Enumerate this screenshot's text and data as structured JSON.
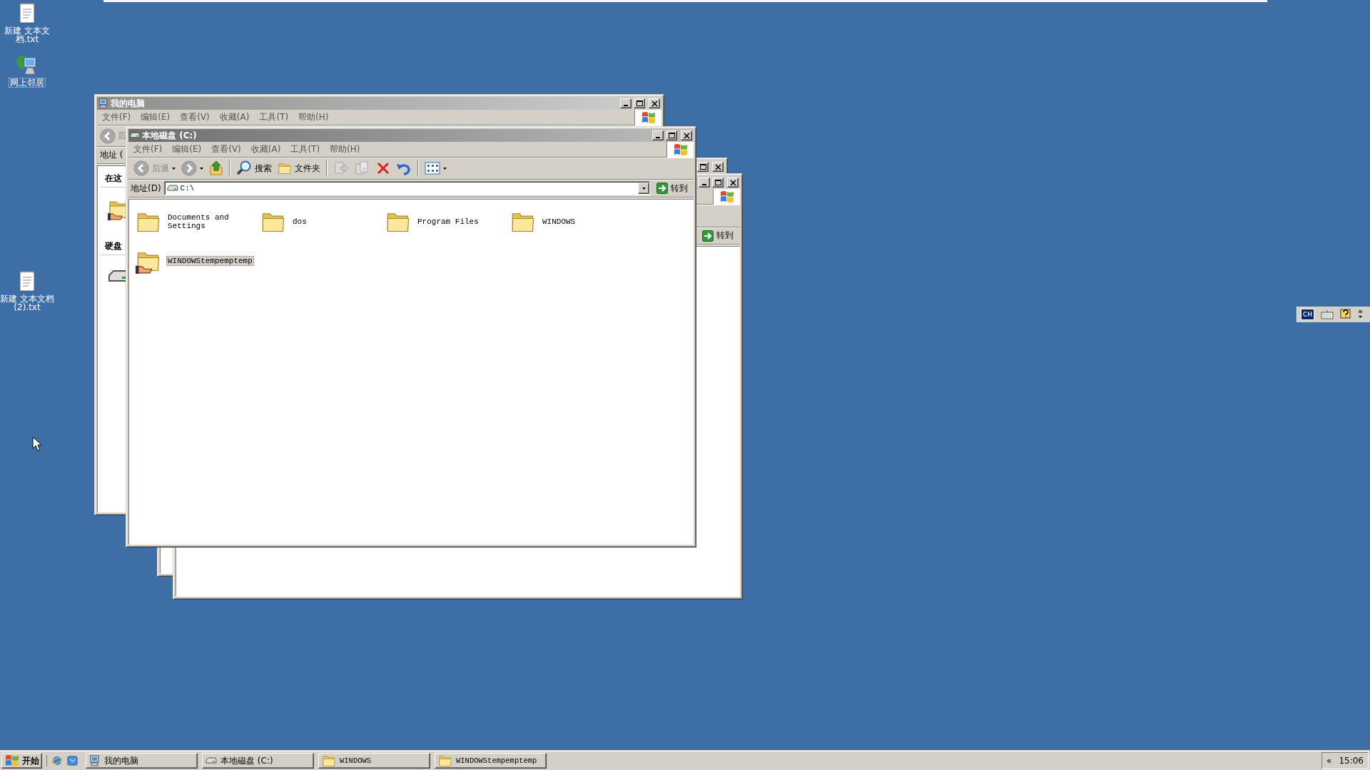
{
  "desktop_icons": [
    {
      "kind": "text-file",
      "label": "新建 文本文档.txt"
    },
    {
      "kind": "network",
      "label": "网上邻居"
    },
    {
      "kind": "text-file",
      "label": "新建 文本文档 (2).txt"
    }
  ],
  "my_computer_window": {
    "title": "我的电脑",
    "active": false,
    "menu": [
      "文件(F)",
      "编辑(E)",
      "查看(V)",
      "收藏(A)",
      "工具(T)",
      "帮助(H)"
    ],
    "back_label": "后",
    "address_label": "地址 (",
    "sections": [
      {
        "heading": "在这",
        "kind": "shared-folder"
      },
      {
        "heading": "硬盘",
        "kind": "drive"
      }
    ]
  },
  "background_windows": [
    {
      "kind": "edge"
    },
    {
      "kind": "explorer",
      "go_button": "转到"
    }
  ],
  "drive_window": {
    "title": "本地磁盘 (C:)",
    "active": true,
    "menu": [
      "文件(F)",
      "编辑(E)",
      "查看(V)",
      "收藏(A)",
      "工具(T)",
      "帮助(H)"
    ],
    "toolbar": [
      {
        "kind": "back",
        "label": "后退",
        "disabled": true
      },
      {
        "kind": "forward",
        "disabled": true
      },
      {
        "kind": "up",
        "disabled": false
      },
      {
        "kind": "separator"
      },
      {
        "kind": "search",
        "label": "搜索",
        "disabled": false
      },
      {
        "kind": "folders",
        "label": "文件夹",
        "disabled": false
      },
      {
        "kind": "separator"
      },
      {
        "kind": "move",
        "disabled": true
      },
      {
        "kind": "copy",
        "disabled": true
      },
      {
        "kind": "delete",
        "disabled": false
      },
      {
        "kind": "undo",
        "disabled": false
      },
      {
        "kind": "separator"
      },
      {
        "kind": "views",
        "disabled": false
      }
    ],
    "address": {
      "label": "地址(D)",
      "value": "C:\\"
    },
    "go_button": "转到",
    "items": [
      {
        "name": "Documents and Settings",
        "shared": false,
        "selected": false
      },
      {
        "name": "dos",
        "shared": false,
        "selected": false
      },
      {
        "name": "Program Files",
        "shared": false,
        "selected": false
      },
      {
        "name": "WINDOWS",
        "shared": false,
        "selected": false
      },
      {
        "name": "WINDOWStempemptemp",
        "shared": true,
        "selected": true
      }
    ]
  },
  "taskbar": {
    "start": "开始",
    "quick_launch": [
      {
        "kind": "browser"
      },
      {
        "kind": "outlook"
      }
    ],
    "tasks": [
      {
        "label": "我的电脑",
        "kind": "computer"
      },
      {
        "label": "本地磁盘 (C:)",
        "kind": "drive"
      },
      {
        "label": "WINDOWS",
        "kind": "folder"
      },
      {
        "label": "WINDOWStempemptemp",
        "kind": "folder"
      }
    ],
    "tray_toggle": "«",
    "clock": "15:06"
  },
  "language_bar": {
    "language": "CH"
  }
}
